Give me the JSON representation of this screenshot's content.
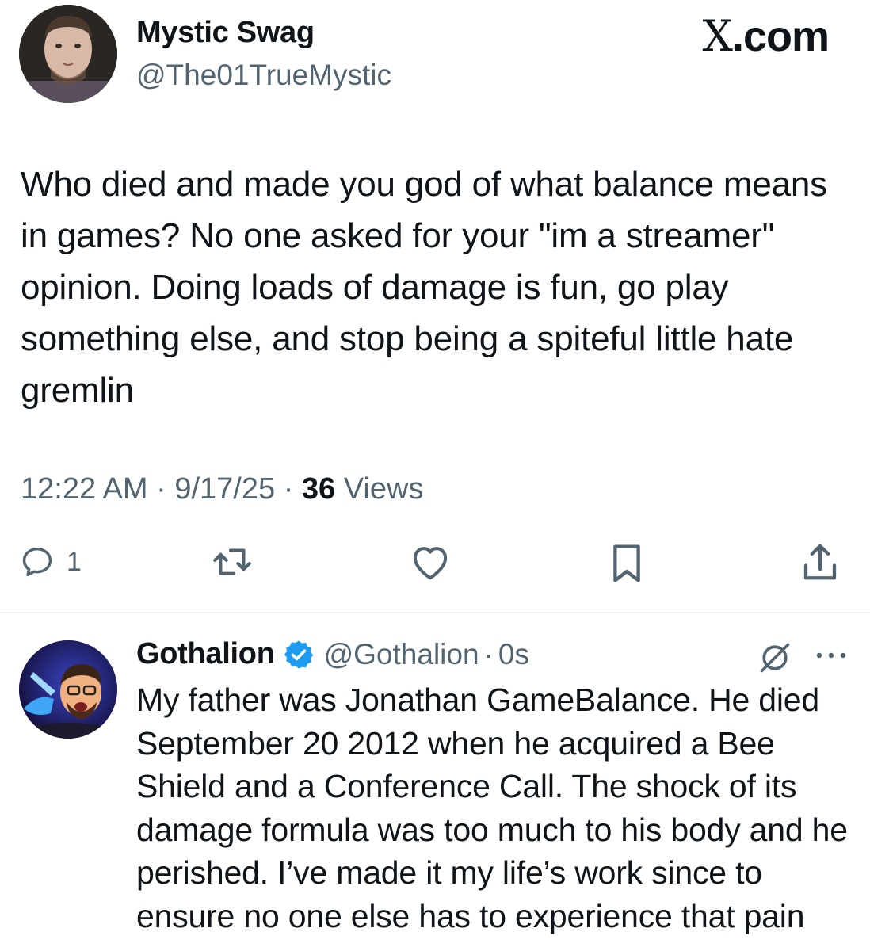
{
  "tweet": {
    "author_name": "Mystic Swag",
    "author_handle": "@The01TrueMystic",
    "brand_x": "X",
    "brand_domain": ".com",
    "text": "Who died and made you god of what balance means in games? No one asked for your \"im a streamer\" opinion. Doing loads of damage is fun, go play something else, and stop being a spiteful little hate gremlin",
    "time": "12:22 AM",
    "date": "9/17/25",
    "separator": "·",
    "views_count": "36",
    "views_label": "Views",
    "reply_count": "1"
  },
  "reply": {
    "author_name": "Gothalion",
    "author_handle": "@Gothalion",
    "separator": "·",
    "time": "0s",
    "text": "My father was Jonathan GameBalance. He died September 20 2012 when he acquired a Bee Shield and a Conference Call. The shock of its damage formula was too much to his body and he perished. I’ve made it my life’s work since to ensure no one else has to experience that pain"
  },
  "icons": {
    "reply": "comment-bubble-icon",
    "retweet": "retweet-arrows-icon",
    "like": "heart-icon",
    "bookmark": "bookmark-icon",
    "share": "share-upload-icon",
    "verified": "verified-badge-icon",
    "grok": "grok-icon",
    "more": "more-dots-icon"
  },
  "colors": {
    "text": "#0f1419",
    "secondary": "#536471",
    "verified": "#1d9bf0",
    "divider": "#eff3f4"
  }
}
